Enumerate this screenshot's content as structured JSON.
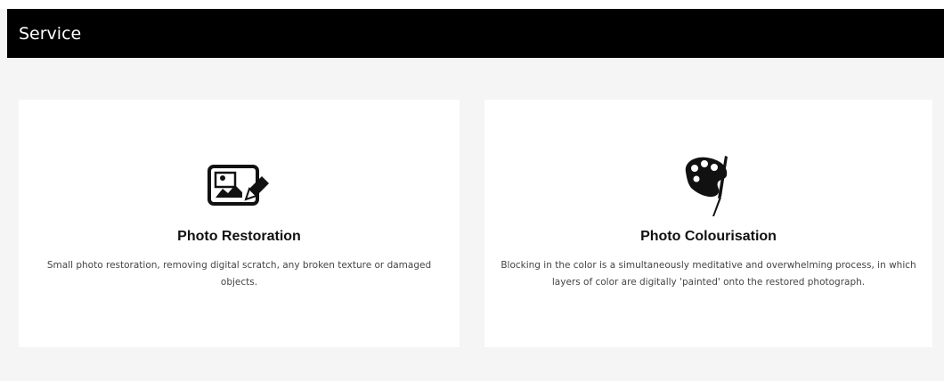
{
  "header": {
    "title": "Service"
  },
  "services": [
    {
      "icon": "image-edit-icon",
      "title": "Photo Restoration",
      "description": "Small photo restoration, removing digital scratch, any broken texture or damaged objects."
    },
    {
      "icon": "palette-brush-icon",
      "title": "Photo Colourisation",
      "description": "Blocking in the color is a simultaneously meditative and overwhelming process, in which layers of color are digitally 'painted' onto the restored photograph."
    }
  ],
  "colors": {
    "header_background": "#000000",
    "header_text": "#ffffff",
    "page_background": "#f5f5f5",
    "card_background": "#ffffff"
  }
}
